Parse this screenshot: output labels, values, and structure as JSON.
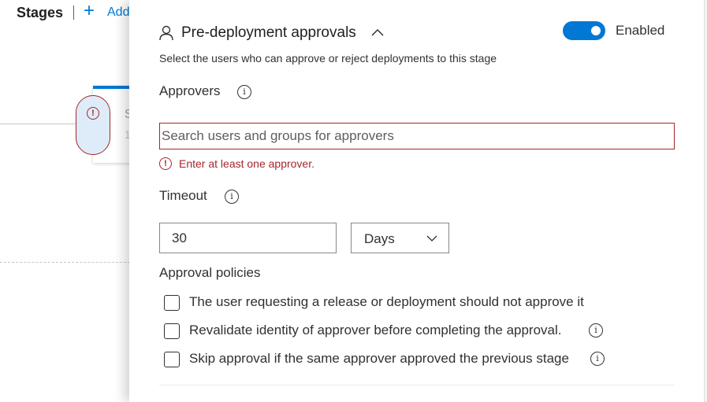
{
  "background": {
    "stages_title": "Stages",
    "add_label": "Add",
    "stage_card_letter": "S",
    "stage_card_sub": "1"
  },
  "panel": {
    "title": "Pre-deployment approvals",
    "toggle_label": "Enabled",
    "toggle_on": true,
    "subtitle": "Select the users who can approve or reject deployments to this stage",
    "approvers_label": "Approvers",
    "approvers_placeholder": "Search users and groups for approvers",
    "error_text": "Enter at least one approver.",
    "timeout_label": "Timeout",
    "timeout_value": "30",
    "timeout_unit": "Days",
    "policies_label": "Approval policies",
    "policies": [
      {
        "label": "The user requesting a release or deployment should not approve it",
        "checked": false,
        "info": false
      },
      {
        "label": "Revalidate identity of approver before completing the approval.",
        "checked": false,
        "info": true
      },
      {
        "label": "Skip approval if the same approver approved the previous stage",
        "checked": false,
        "info": true
      }
    ]
  },
  "colors": {
    "accent": "#0078d4",
    "error": "#a4262c",
    "text": "#323130"
  },
  "icons": {
    "info": "i",
    "error": "!"
  }
}
